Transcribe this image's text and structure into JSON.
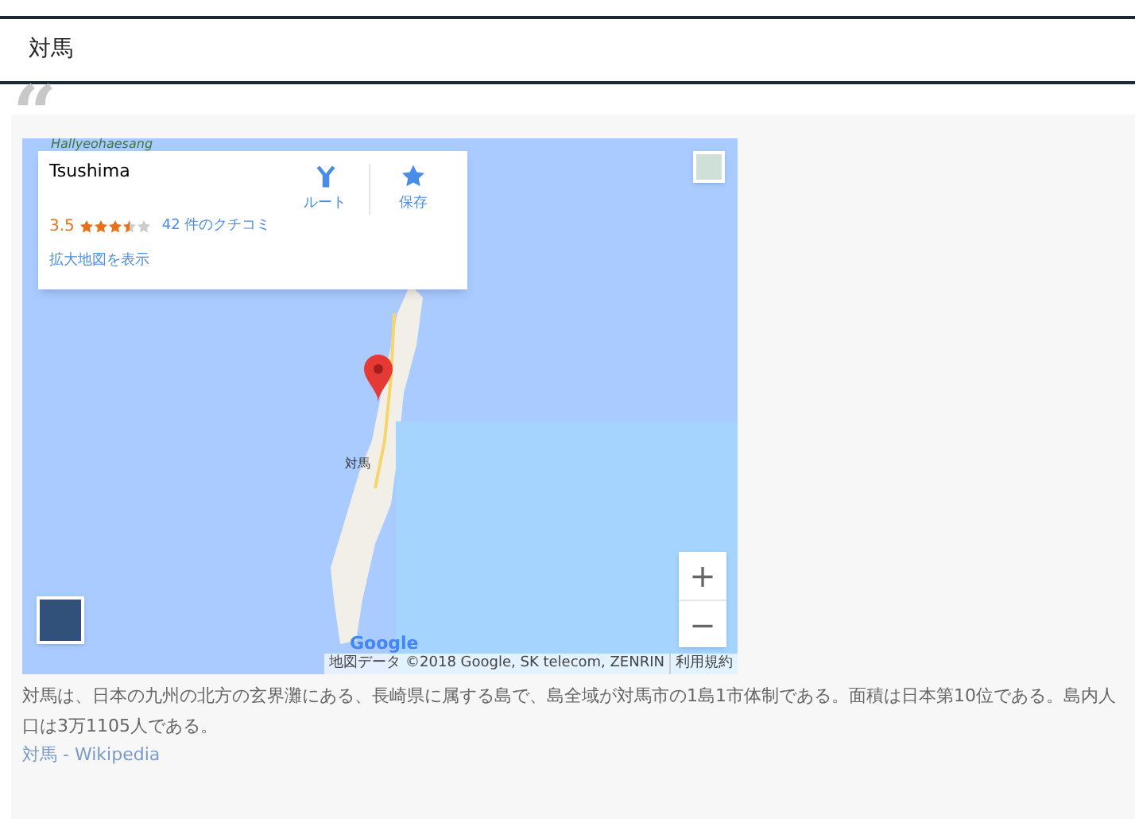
{
  "header": {
    "title": "対馬"
  },
  "quote_mark": "“",
  "map": {
    "region_label": "Hallyeohaesang",
    "place_label": "対馬",
    "info_card": {
      "name": "Tsushima",
      "rating": "3.5",
      "stars": 3.5,
      "reviews": "42 件のクチコミ",
      "link": "拡大地図を表示",
      "actions": [
        {
          "kind": "route",
          "label": "ルート"
        },
        {
          "kind": "save",
          "label": "保存"
        }
      ]
    },
    "zoom_controls": [
      "+",
      "−"
    ],
    "logo": "Google",
    "attribution": "地図データ ©2018 Google, SK telecom, ZENRIN",
    "terms": "利用規約"
  },
  "description": "対馬は、日本の九州の北方の玄界灘にある、長崎県に属する島で、島全域が対馬市の1島1市体制である。面積は日本第10位である。島内人口は3万1105人である。",
  "source": {
    "title": "対馬",
    "separator": " - ",
    "site": "Wikipedia"
  }
}
